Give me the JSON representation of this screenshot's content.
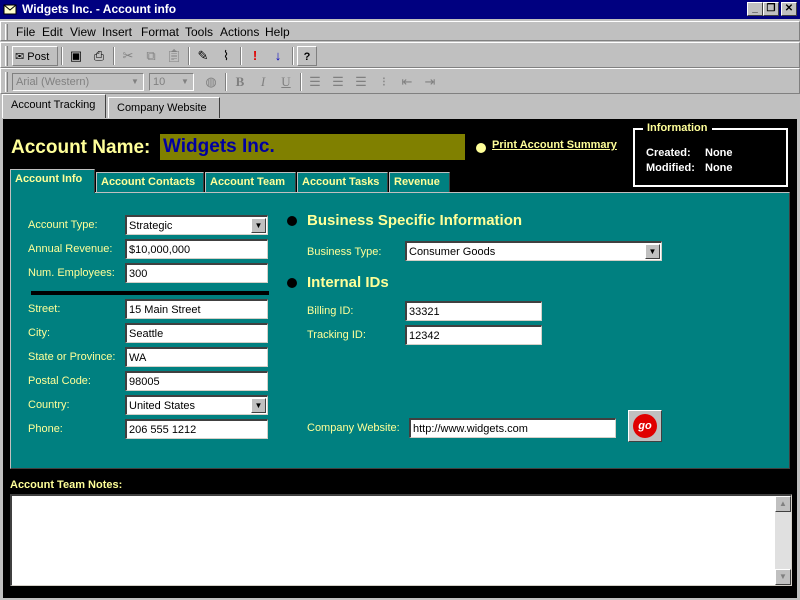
{
  "window": {
    "title": "Widgets Inc. - Account info"
  },
  "menu": [
    "File",
    "Edit",
    "View",
    "Insert",
    "Format",
    "Tools",
    "Actions",
    "Help"
  ],
  "toolbar": {
    "post_label": "Post"
  },
  "format_toolbar": {
    "font_value": "Arial (Western)",
    "size_value": "10"
  },
  "page_tabs": [
    "Account Tracking",
    "Company Website"
  ],
  "account": {
    "name_label": "Account Name:",
    "name_value": "Widgets Inc.",
    "print_link": "Print Account Summary"
  },
  "info_box": {
    "legend": "Information",
    "created_label": "Created:",
    "created_value": "None",
    "modified_label": "Modified:",
    "modified_value": "None"
  },
  "inner_tabs": [
    "Account Info",
    "Account Contacts",
    "Account Team",
    "Account Tasks",
    "Revenue"
  ],
  "left_fields": [
    {
      "label": "Account Type:",
      "value": "Strategic"
    },
    {
      "label": "Annual Revenue:",
      "value": "$10,000,000"
    },
    {
      "label": "Num. Employees:",
      "value": "300"
    },
    {
      "label": "Street:",
      "value": "15 Main Street"
    },
    {
      "label": "City:",
      "value": "Seattle"
    },
    {
      "label": "State or Province:",
      "value": "WA"
    },
    {
      "label": "Postal Code:",
      "value": "98005"
    },
    {
      "label": "Country:",
      "value": "United States"
    },
    {
      "label": "Phone:",
      "value": "206 555 1212"
    }
  ],
  "business": {
    "heading": "Business Specific Information",
    "type_label": "Business Type:",
    "type_value": "Consumer Goods"
  },
  "internal_ids": {
    "heading": "Internal IDs",
    "billing_label": "Billing ID:",
    "billing_value": "33321",
    "tracking_label": "Tracking ID:",
    "tracking_value": "12342"
  },
  "website": {
    "label": "Company Website:",
    "value": "http://www.widgets.com",
    "go_label": "go"
  },
  "notes": {
    "label": "Account Team Notes:",
    "value": ""
  },
  "colors": {
    "title_bar": "#000080",
    "form_bg": "#000000",
    "panel_bg": "#008080",
    "label_text": "#ffff99",
    "name_field_bg": "#808000",
    "name_text": "#0000a0"
  }
}
